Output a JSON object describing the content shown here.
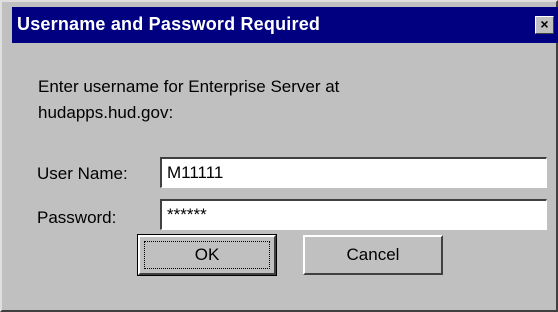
{
  "dialog": {
    "title": "Username and Password Required",
    "close_glyph": "×",
    "prompt_line1": "Enter username for Enterprise Server at",
    "prompt_line2": "hudapps.hud.gov:",
    "username": {
      "label": "User Name:",
      "value": "M11111"
    },
    "password": {
      "label": "Password:",
      "value": "******"
    },
    "buttons": {
      "ok_label": "OK",
      "cancel_label": "Cancel"
    }
  },
  "colors": {
    "titlebar": "#000080",
    "face": "#c0c0c0",
    "input_bg": "#ffffff"
  },
  "icons": {
    "close": "close-icon"
  }
}
